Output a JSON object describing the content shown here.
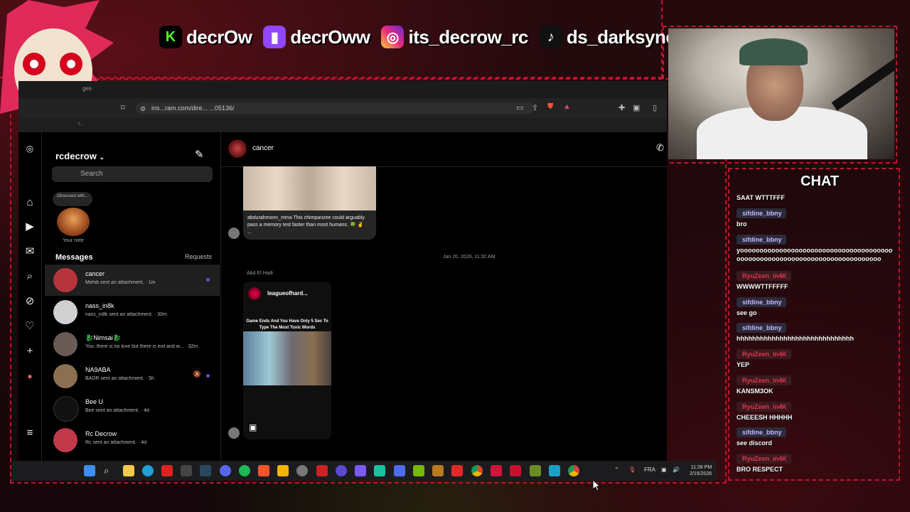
{
  "social": [
    {
      "icon": "kick-icon",
      "label": "decrOw",
      "color": "#53fc18",
      "glyph": "K"
    },
    {
      "icon": "twitch-icon",
      "label": "decrOww",
      "color": "#9146ff",
      "glyph": "▮"
    },
    {
      "icon": "instagram-icon",
      "label": "its_decrow_rc",
      "color": "#e1306c",
      "glyph": "◎"
    },
    {
      "icon": "tiktok-icon",
      "label": "ds_darksync",
      "color": "#111111",
      "glyph": "♪"
    }
  ],
  "browser": {
    "tab_fragment": "ges",
    "url": "ins...ram.com/dire...     ...05136/",
    "bookmark_fragment": "t.."
  },
  "instagram": {
    "account": "rcdecrow",
    "search_placeholder": "Search",
    "note_text": "Obsessed with...",
    "note_label": "Your note",
    "messages_heading": "Messages",
    "requests_label": "Requests",
    "conversations": [
      {
        "name": "cancer",
        "preview": "Mehdi sent an attachment. · 1m",
        "unread": true,
        "muted": false,
        "color": "#b8343c"
      },
      {
        "name": "nass_in8k",
        "preview": "nass_in8k sent an attachment. · 30m",
        "unread": false,
        "muted": false,
        "color": "#d0d0d0"
      },
      {
        "name": "🐉Nimsai🐉",
        "preview": "You: there is no love but there is evil and w... · 32m",
        "unread": false,
        "muted": false,
        "color": "#6a5a55"
      },
      {
        "name": "NA9ABA",
        "preview": "BADR sent an attachment. · 5h",
        "unread": true,
        "muted": true,
        "color": "#8a7050"
      },
      {
        "name": "Bee U",
        "preview": "Bee sent an attachment. · 4d",
        "unread": false,
        "muted": false,
        "color": "#111111"
      },
      {
        "name": "Rc Decrow",
        "preview": "Rc sent an attachment. · 4d",
        "unread": false,
        "muted": false,
        "color": "#c23a4a"
      }
    ],
    "chat": {
      "name": "cancer",
      "post_caption": "abdurahmonn_mma This chimpanzee could arguably pass a memory test faster than most humans. 🍀 ✌ ...",
      "timestamp": "Jan 20, 2026, 11:32 AM",
      "sender": "Abd El Hadi",
      "reel_account": "leagueofhard...",
      "reel_title": "Game Ends And You Have Only 5 Sec To Type The Most Toxic Words"
    }
  },
  "taskbar": {
    "language": "FRA",
    "time": "11:28 PM",
    "date": "2/15/2026"
  },
  "stream_chat": {
    "title": "CHAT",
    "messages": [
      {
        "user": "",
        "text": "SAAT WTTTFFF",
        "type": "s"
      },
      {
        "user": "sifdine_bbny",
        "text": "bro",
        "type": "s"
      },
      {
        "user": "sifdine_bbny",
        "text": "yoooooooooooooooooooooooooooooooooooooooooooooooooooooooooooooooooooooooooooo",
        "type": "s"
      },
      {
        "user": "RyuZeen_in4K",
        "text": "WWWWTTFFFFF",
        "type": "r"
      },
      {
        "user": "sifdine_bbny",
        "text": "see go",
        "type": "s"
      },
      {
        "user": "sifdine_bbny",
        "text": "hhhhhhhhhhhhhhhhhhhhhhhhhhhhhh",
        "type": "s"
      },
      {
        "user": "RyuZeen_in4K",
        "text": "YEP",
        "type": "r"
      },
      {
        "user": "RyuZeen_in4K",
        "text": "KANSM3OK",
        "type": "r"
      },
      {
        "user": "RyuZeen_in4K",
        "text": "CHEEESH HHHHH",
        "type": "r"
      },
      {
        "user": "sifdine_bbny",
        "text": "see discord",
        "type": "s"
      },
      {
        "user": "RyuZeen_in4K",
        "text": "BRO RESPECT",
        "type": "r"
      }
    ]
  }
}
